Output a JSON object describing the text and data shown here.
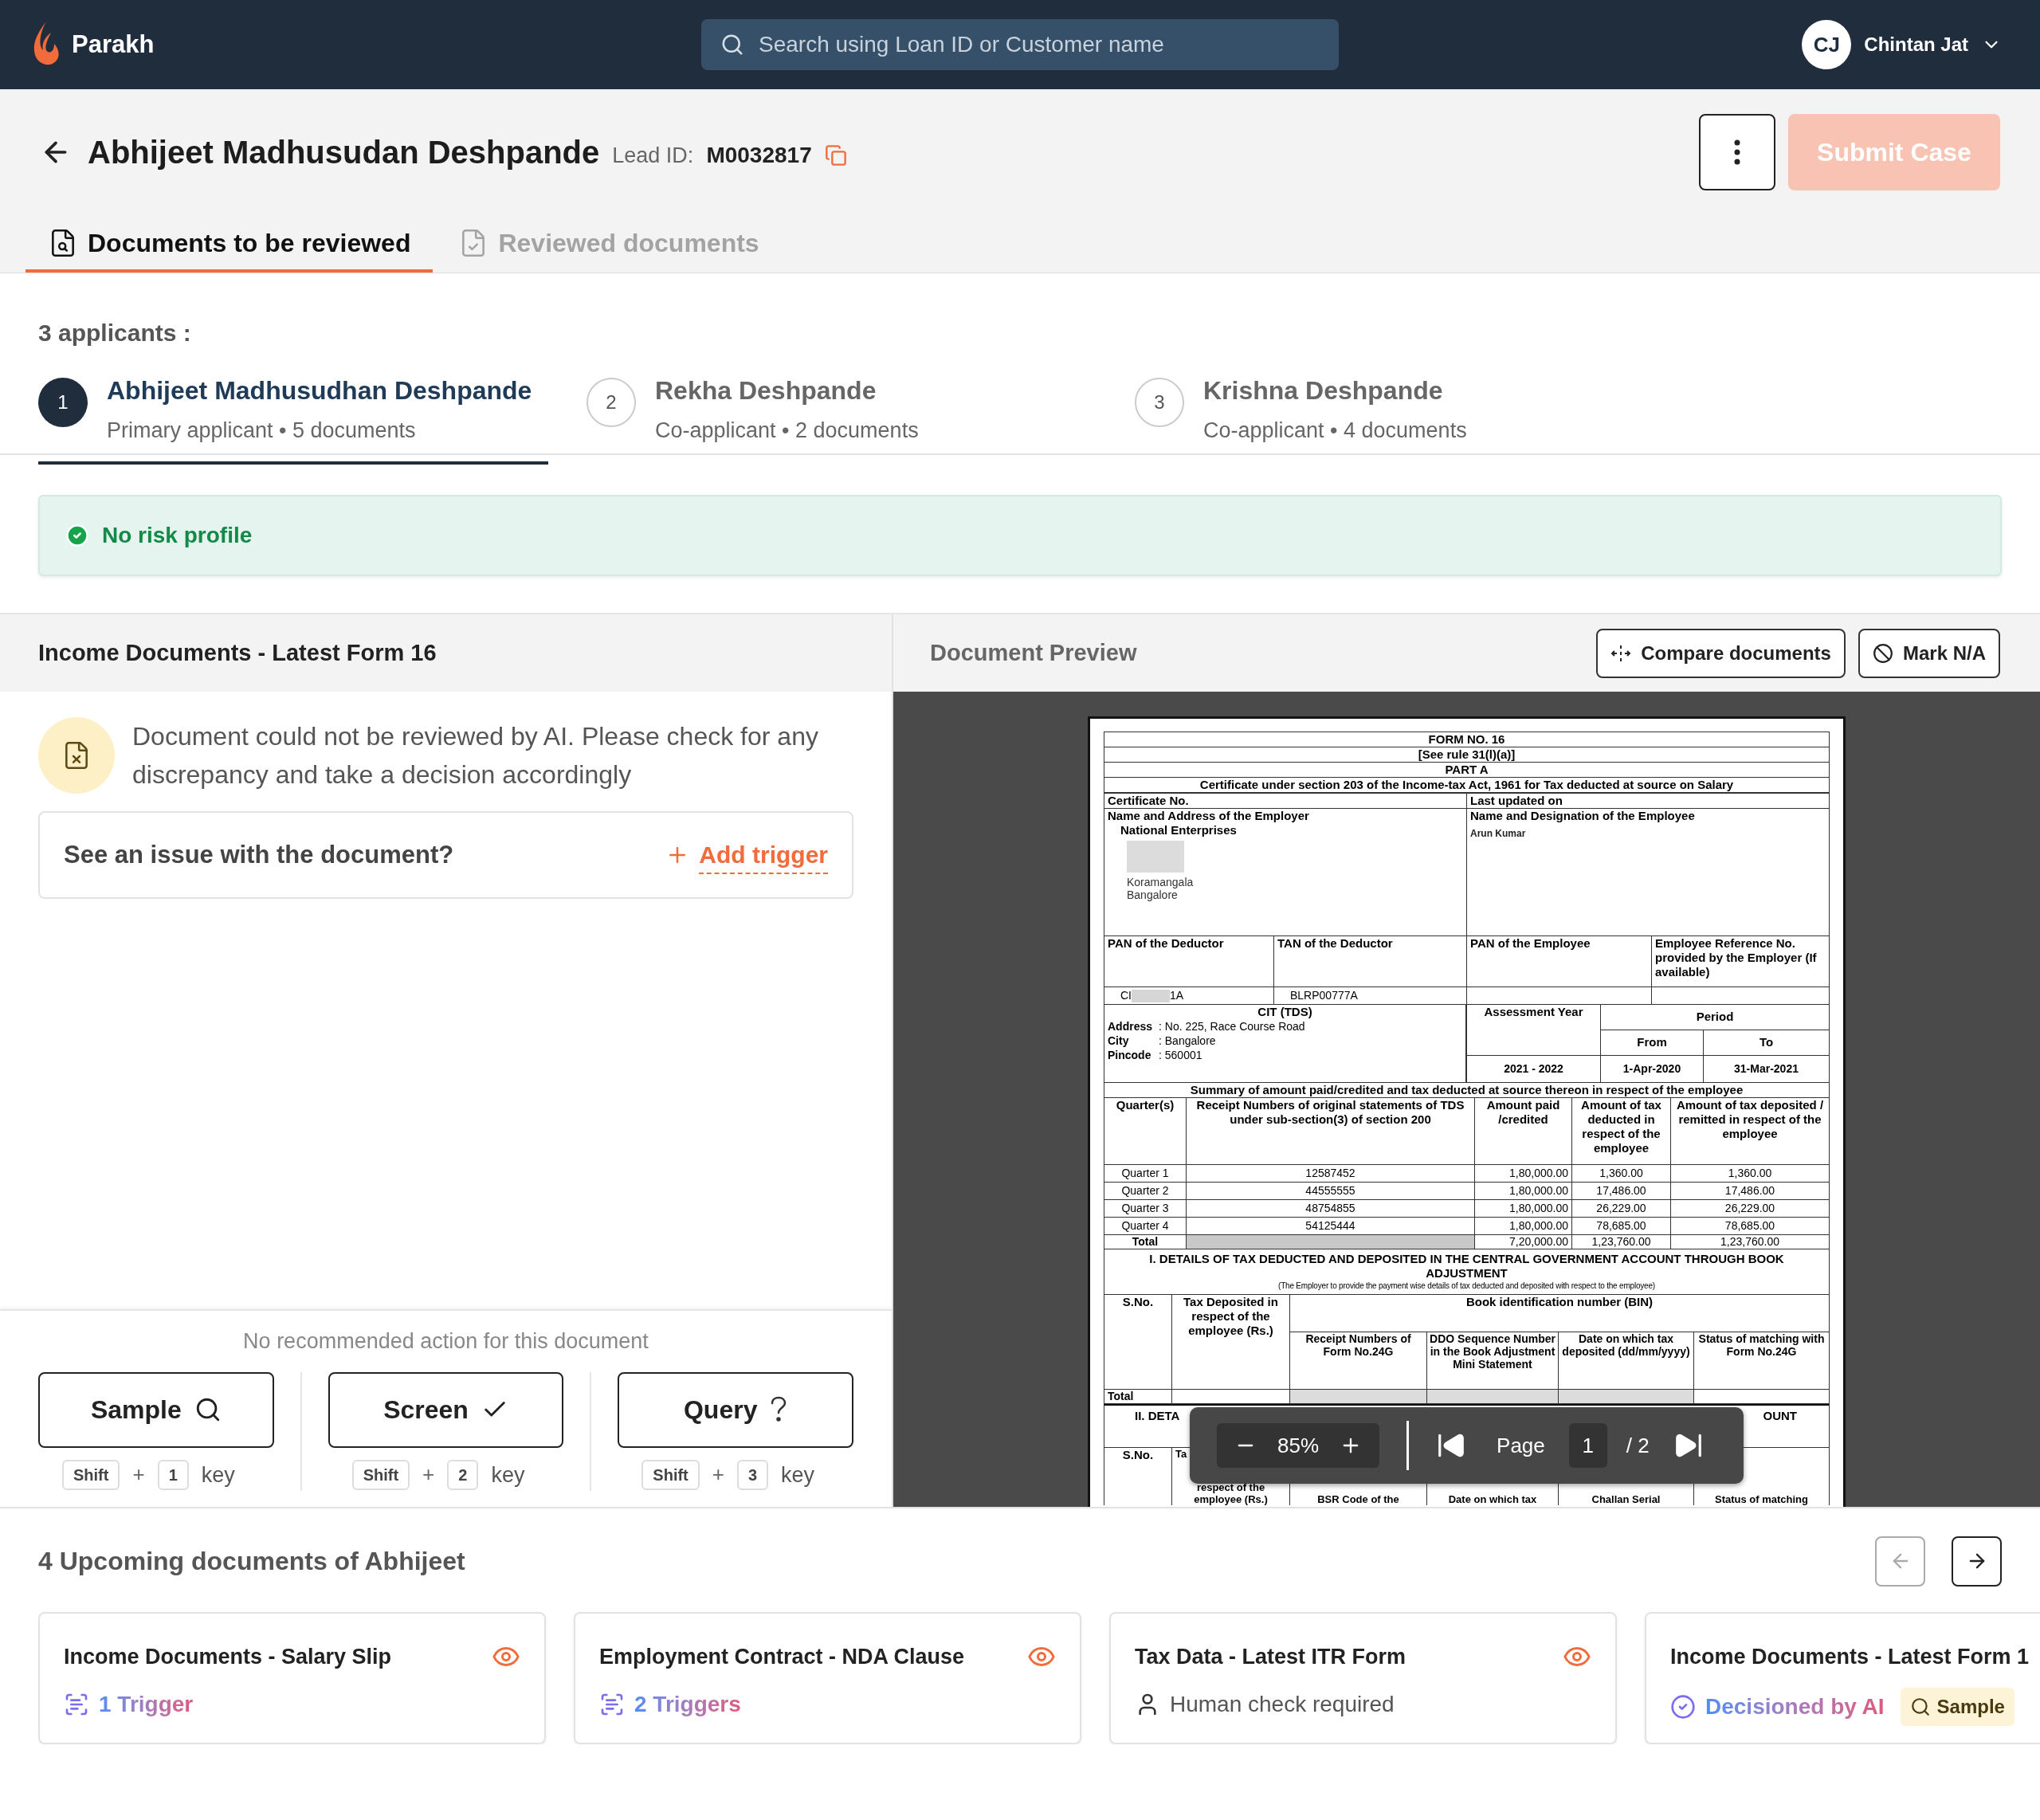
{
  "app": {
    "name": "Parakh"
  },
  "search": {
    "placeholder": "Search using Loan ID or Customer name"
  },
  "user": {
    "initials": "CJ",
    "name": "Chintan Jat"
  },
  "case": {
    "name": "Abhijeet Madhusudan Deshpande",
    "lead_label": "Lead ID:",
    "lead_id": "M0032817"
  },
  "submit_button": {
    "label": "Submit Case",
    "disabled": true
  },
  "tabs": [
    {
      "label": "Documents to be reviewed",
      "selected": true
    },
    {
      "label": "Reviewed documents",
      "selected": false
    }
  ],
  "applicants_heading": "3 applicants :",
  "applicants": [
    {
      "number": "1",
      "name": "Abhijeet Madhusudhan Deshpande",
      "details": "Primary applicant • 5 documents",
      "selected": true
    },
    {
      "number": "2",
      "name": "Rekha Deshpande",
      "details": "Co-applicant • 2 documents",
      "selected": false
    },
    {
      "number": "3",
      "name": "Krishna Deshpande",
      "details": "Co-applicant • 4 documents",
      "selected": false
    }
  ],
  "risk_banner": {
    "label": "No risk profile"
  },
  "document_panel": {
    "title": "Income Documents - Latest Form 16",
    "ai_notice": "Document could not be reviewed by AI. Please check for any discrepancy and take a decision accordingly",
    "issue_prompt": "See an issue with the document?",
    "add_trigger": "Add trigger",
    "recommendation": "No recommended action for this document",
    "actions": [
      {
        "label": "Sample",
        "kind": "sample",
        "modifier": "Shift",
        "plus": "+",
        "key": "1",
        "key_word": "key"
      },
      {
        "label": "Screen",
        "kind": "screen",
        "modifier": "Shift",
        "plus": "+",
        "key": "2",
        "key_word": "key"
      },
      {
        "label": "Query",
        "kind": "query",
        "modifier": "Shift",
        "plus": "+",
        "key": "3",
        "key_word": "key"
      }
    ]
  },
  "preview": {
    "title": "Document Preview",
    "buttons": [
      {
        "label": "Compare documents",
        "kind": "compare"
      },
      {
        "label": "Mark N/A",
        "kind": "na"
      }
    ],
    "zoom": "85%",
    "page_label": "Page",
    "page": "1",
    "page_total": "/ 2",
    "document": {
      "title": "FORM NO. 16",
      "rule": "[See rule 31(l)(a)]",
      "part": "PART A",
      "heading": "Certificate under section 203 of the Income-tax Act, 1961 for Tax deducted at source on Salary",
      "certificate_no": "Certificate No.",
      "last_updated": "Last updated on",
      "employer_label": "Name and Address of the Employer",
      "employer_name": "National Enterprises",
      "employer_address": [
        "Koramangala",
        "Bangalore"
      ],
      "employee_label": "Name and Designation of the Employee",
      "employee_name": "Arun Kumar",
      "id_columns": [
        "PAN of the Deductor",
        "TAN of the Deductor",
        "PAN of the Employee",
        "Employee Reference No. provided by the Employer (If available)"
      ],
      "pan_deductor_start": "CI",
      "pan_deductor_end": "1A",
      "tan_deductor": "BLRP00777A",
      "cit_title": "CIT (TDS)",
      "cit_lines": [
        {
          "label": "Address",
          "value": ": No. 225, Race Course Road"
        },
        {
          "label": "City",
          "value": ": Bangalore"
        },
        {
          "label": "Pincode",
          "value": ": 560001"
        }
      ],
      "assessment_year_label": "Assessment Year",
      "period_label": "Period",
      "from_label": "From",
      "to_label": "To",
      "assessment_year": "2021 - 2022",
      "period_from": "1-Apr-2020",
      "period_to": "31-Mar-2021",
      "summary_heading": "Summary of amount paid/credited and tax deducted at source thereon in respect of the employee",
      "summary_columns": [
        "Quarter(s)",
        "Receipt Numbers of original statements of TDS under sub-section(3) of section 200",
        "Amount paid /credited",
        "Amount of tax deducted in respect of the employee",
        "Amount of tax deposited / remitted in respect of the employee"
      ],
      "quarters": [
        {
          "quarter": "Quarter 1",
          "receipt": "12587452",
          "paid": "1,80,000.00",
          "deducted": "1,360.00",
          "deposited": "1,360.00"
        },
        {
          "quarter": "Quarter 2",
          "receipt": "44555555",
          "paid": "1,80,000.00",
          "deducted": "17,486.00",
          "deposited": "17,486.00"
        },
        {
          "quarter": "Quarter 3",
          "receipt": "48754855",
          "paid": "1,80,000.00",
          "deducted": "26,229.00",
          "deposited": "26,229.00"
        },
        {
          "quarter": "Quarter 4",
          "receipt": "54125444",
          "paid": "1,80,000.00",
          "deducted": "78,685.00",
          "deposited": "78,685.00"
        }
      ],
      "total": {
        "label": "Total",
        "paid": "7,20,000.00",
        "deducted": "1,23,760.00",
        "deposited": "1,23,760.00"
      },
      "section_1_heading": "I. DETAILS OF TAX DEDUCTED AND DEPOSITED IN THE CENTRAL GOVERNMENT ACCOUNT THROUGH BOOK ADJUSTMENT",
      "section_1_note": "(The Employer to provide the payment wise details of tax deducted and deposited with respect to the employee)",
      "section_1_columns": [
        "S.No.",
        "Tax Deposited in respect of the employee (Rs.)",
        "Book identification number (BIN)",
        "Receipt Numbers of Form No.24G",
        "DDO Sequence Number in the Book Adjustment Mini Statement",
        "Date on which tax deposited (dd/mm/yyyy)",
        "Status of matching with Form No.24G"
      ],
      "section_1_total": "Total",
      "section_2_heading_start": "II. DETA",
      "section_2_heading_end": "OUNT",
      "section_2_columns": [
        "S.No.",
        "Ta",
        "respect of the employee (Rs.)",
        "BSR Code of the",
        "Date on which tax",
        "Challan Serial",
        "Status of matching"
      ]
    }
  },
  "upcoming": {
    "title": "4 Upcoming documents of Abhijeet",
    "nav": [
      {
        "kind": "prev",
        "disabled": true
      },
      {
        "kind": "next",
        "disabled": false
      }
    ],
    "cards": [
      {
        "title": "Income Documents - Salary Slip",
        "kind": "triggers",
        "status": "1 Trigger"
      },
      {
        "title": "Employment Contract - NDA Clause",
        "kind": "triggers",
        "status": "2 Triggers"
      },
      {
        "title": "Tax Data - Latest ITR Form",
        "kind": "human",
        "status": "Human check required"
      },
      {
        "title": "Income Documents - Latest Form 1",
        "kind": "ai",
        "status": "Decisioned by AI",
        "badge": "Sample"
      }
    ]
  }
}
